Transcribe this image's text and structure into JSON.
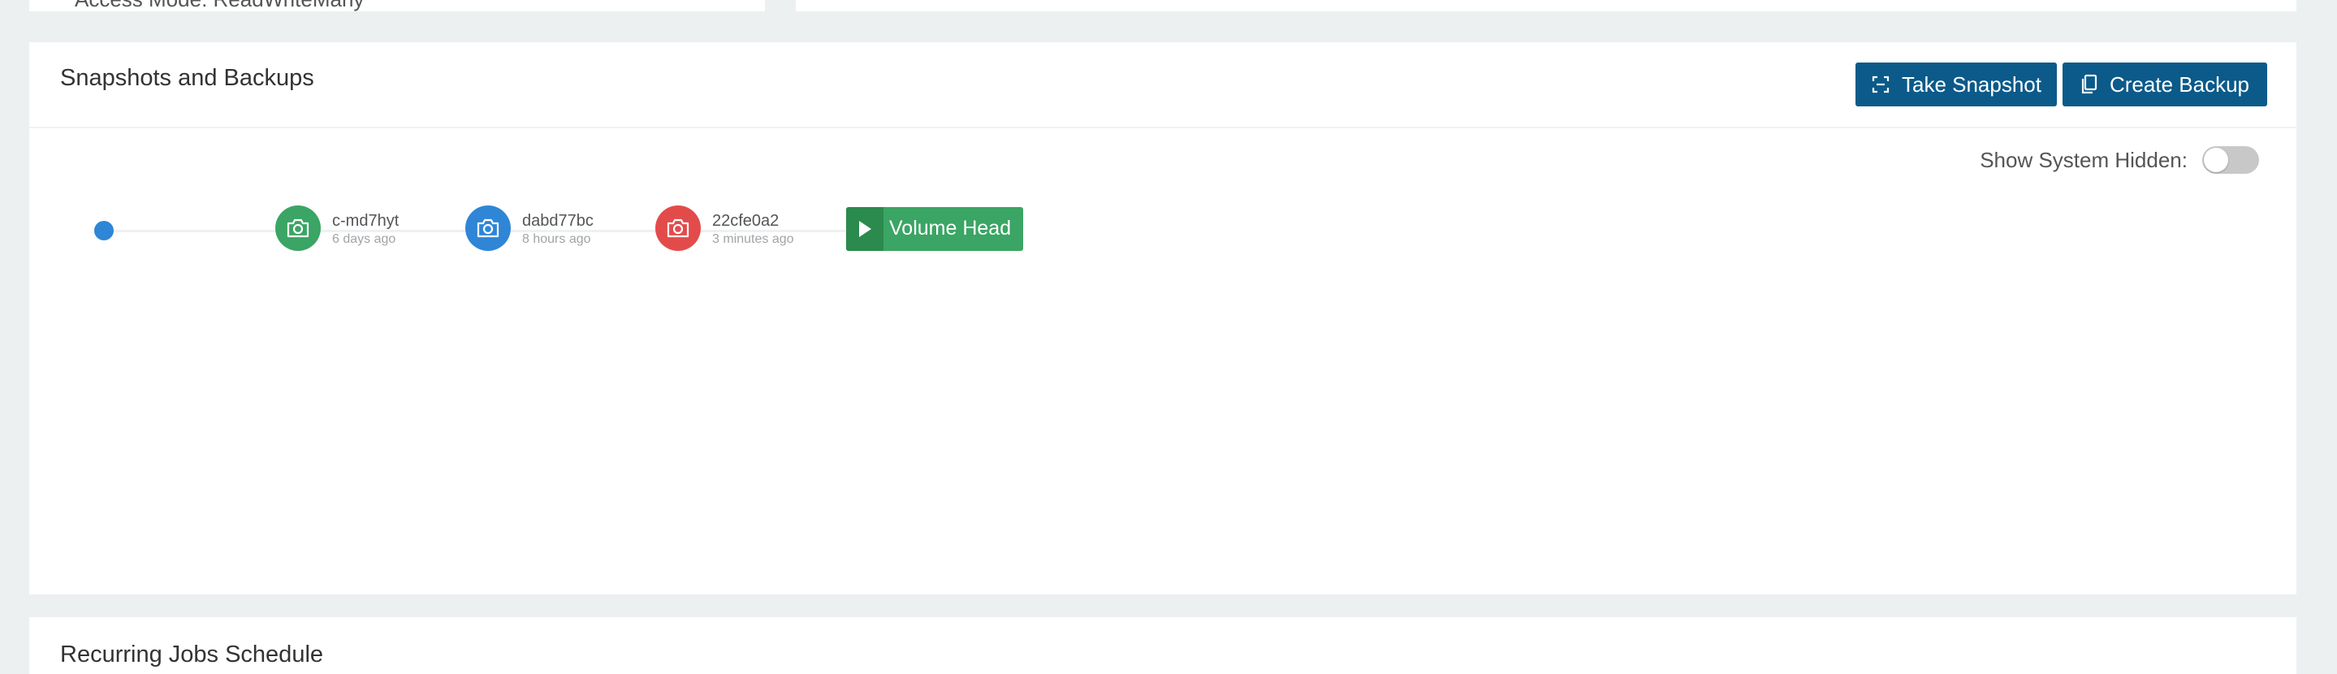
{
  "top_left_card": {
    "text": "Access Mode: ReadWriteMany"
  },
  "snapshots_section": {
    "title": "Snapshots and Backups",
    "buttons": {
      "take_snapshot": "Take Snapshot",
      "create_backup": "Create Backup"
    },
    "show_system_hidden": {
      "label": "Show System Hidden:",
      "enabled": false
    },
    "snapshots": [
      {
        "name": "c-md7hyt",
        "time": "6 days ago",
        "color": "#3aa564",
        "icon": "camera-icon"
      },
      {
        "name": "dabd77bc",
        "time": "8 hours ago",
        "color": "#2f86d6",
        "icon": "camera-icon"
      },
      {
        "name": "22cfe0a2",
        "time": "3 minutes ago",
        "color": "#e34b4b",
        "icon": "camera-icon"
      }
    ],
    "volume_head": {
      "label": "Volume Head",
      "icon": "play-icon"
    }
  },
  "recurring_section": {
    "title": "Recurring Jobs Schedule"
  },
  "colors": {
    "primary_button": "#0b5a8a",
    "volume_head": "#3aa564",
    "volume_head_dark": "#2b8a4e",
    "timeline_start": "#2f86d6",
    "background": "#ecf0f1"
  }
}
